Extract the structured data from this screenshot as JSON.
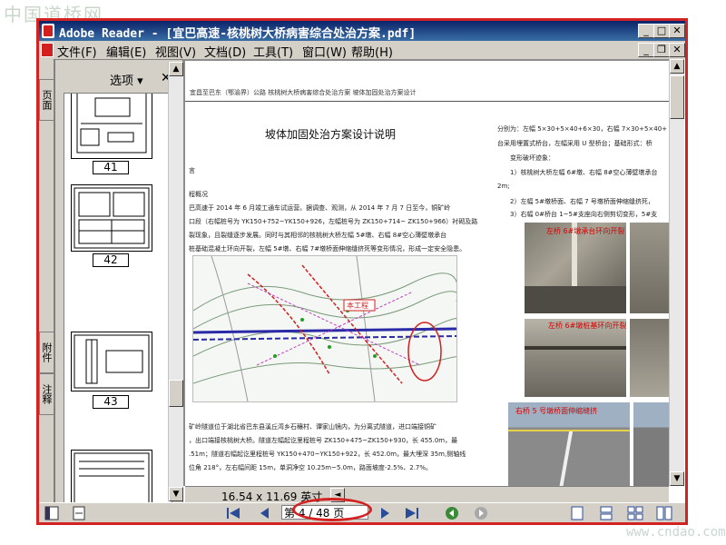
{
  "watermark_top": "中国道桥网",
  "watermark_bottom": "www.cndao.com",
  "window": {
    "title": "Adobe Reader - [宜巴高速-核桃树大桥病害综合处治方案.pdf]",
    "minimize": "_",
    "maximize": "□",
    "close": "✕"
  },
  "menu": [
    {
      "label": "文件(F)"
    },
    {
      "label": "编辑(E)"
    },
    {
      "label": "视图(V)"
    },
    {
      "label": "文档(D)"
    },
    {
      "label": "工具(T)"
    },
    {
      "label": "窗口(W)"
    },
    {
      "label": "帮助(H)"
    }
  ],
  "side_tabs": {
    "pages": "页面",
    "attachments": "附件",
    "comments": "注释"
  },
  "nav_panel": {
    "options_label": "选项 ▾",
    "close": "✕"
  },
  "thumbnails": [
    {
      "label": "41"
    },
    {
      "label": "42"
    },
    {
      "label": "43"
    },
    {
      "label": ""
    }
  ],
  "document": {
    "header": "宜昌至巴东（鄂渝界）公路 核桃树大桥病害综合处治方案 坡体加固处治方案设计",
    "section_title": "坡体加固处治方案设计说明",
    "left_lines": [
      "言",
      "程概况",
      "巴高速于 2014 年 6 月竣工通车试运营。据调查、观测，从 2014 年 7 月 7 日至今，铜矿岭",
      "口段（右幅桩号为 YK150+752~YK150+926，左幅桩号为 ZK150+714~ ZK150+966）衬砌及路",
      "裂现象，且裂缝逐步发展。同时与其相邻的核桃树大桥左幅 5#墩、右幅 8#空心薄壁墩承台",
      "桩基础混凝土环向开裂，左幅 5#墩、右幅 7#墩桥面伸缩缝挤死等变形情况，形成一定安全隐患。"
    ],
    "bottom_lines": [
      "矿岭隧道位于湖北省巴东县溪丘湾乡石穰村、谭家山镜内，为分离式隧道，进口端接铜矿",
      "，出口端接核桃树大桥。隧道左幅起讫里程桩号 ZK150+475~ZK150+930，长 455.0m，最",
      ".51m；隧道右幅起讫里程桩号 YK150+470~YK150+922，长 452.0m，最大埋深 35m,侧轴线",
      "位角 218°，左右幅间距 15m，单洞净空 10.25m~5.0m，路面坡度-2.5%、2.7%。"
    ],
    "right_lines": [
      "分别为：左幅 5×30+5×40+6×30，右幅 7×30+5×40+",
      "台采用埋置式桥台，左幅采用 U 型桥台；基础形式：桥",
      "变形破坏迹象：",
      "1）核桃树大桥左幅 6#墩、右幅 8#空心薄壁墩承台",
      "2m;",
      "2）左幅 5#墩桥面、右幅 7 号墩桥面伸缩缝挤死，",
      "3）右幅 0#桥台 1~5#支座向右侧剪切变形，5#支"
    ],
    "map_label": "本工程",
    "captions": [
      "左桥 6#墩承台环向开裂",
      "左桥 6#墩桩基环向开裂",
      "右桥 5 号墩桥面伸缩缝挤"
    ]
  },
  "page_size": "16.54 x 11.69 英寸",
  "page_indicator": "第 4 / 48 页",
  "colors": {
    "title_bar": "#0a246a",
    "chrome": "#d4d0c8",
    "annotation_red": "#d32222",
    "caption_red": "#d40000"
  },
  "icons": [
    "pdf-icon",
    "first-page-icon",
    "prev-page-icon",
    "next-page-icon",
    "last-page-icon",
    "go-back-icon",
    "go-forward-icon",
    "single-page-icon",
    "continuous-icon",
    "facing-icon",
    "continuous-facing-icon"
  ]
}
